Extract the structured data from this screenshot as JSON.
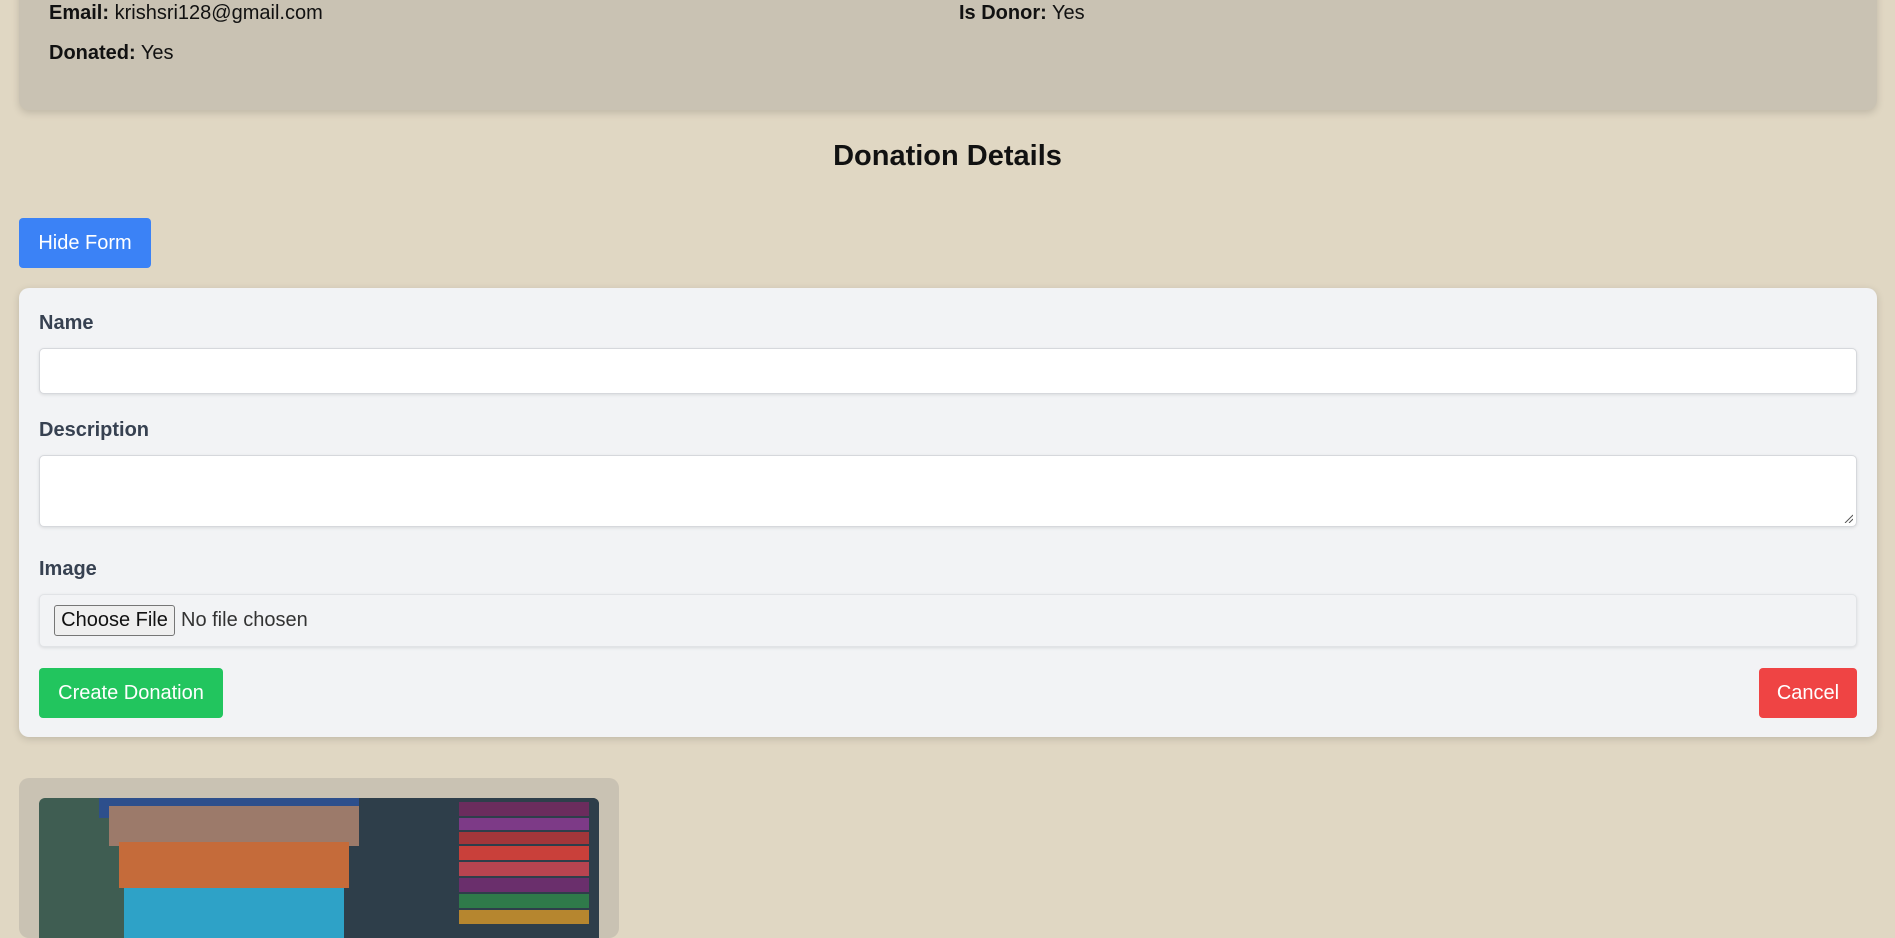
{
  "profile": {
    "email_label": "Email:",
    "email_value": "krishsri128@gmail.com",
    "is_donor_label": "Is Donor:",
    "is_donor_value": "Yes",
    "donated_label": "Donated:",
    "donated_value": "Yes"
  },
  "section_title": "Donation Details",
  "toggle_form_label": "Hide Form",
  "form": {
    "name_label": "Name",
    "name_value": "",
    "description_label": "Description",
    "description_value": "",
    "image_label": "Image",
    "choose_file_label": "Choose File",
    "file_status": "No file chosen",
    "submit_label": "Create Donation",
    "cancel_label": "Cancel"
  },
  "colors": {
    "page_bg": "#e0d7c3",
    "card_bg": "#c9c2b3",
    "primary": "#3b82f6",
    "success": "#22c55e",
    "danger": "#ef4444"
  },
  "donation_card": {
    "image_alt": "books-photo"
  }
}
